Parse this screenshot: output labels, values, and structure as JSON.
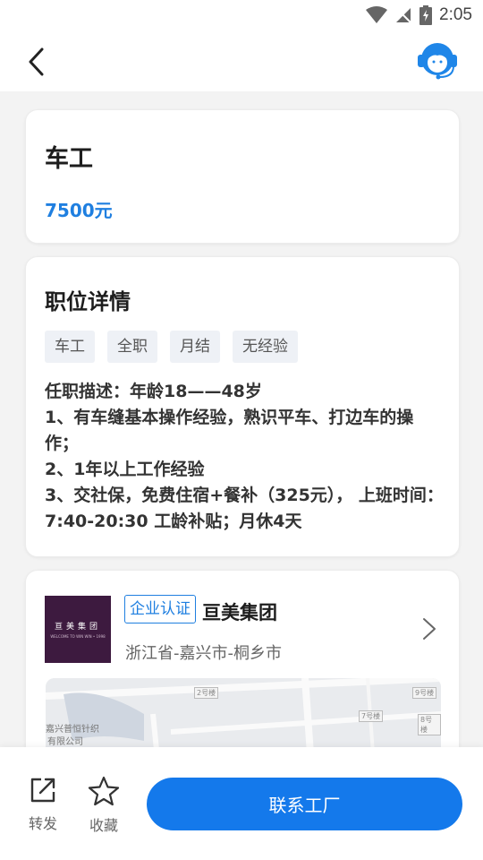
{
  "status_bar": {
    "time": "2:05"
  },
  "job": {
    "title": "车工",
    "salary": "7500元"
  },
  "detail": {
    "heading": "职位详情",
    "tags": [
      "车工",
      "全职",
      "月结",
      "无经验"
    ],
    "description_lines": [
      "任职描述：年龄18——48岁",
      "1、有车缝基本操作经验，熟识平车、打边车的操作；",
      "2、1年以上工作经验",
      "3、交社保，免费住宿+餐补（325元）， 上班时间：7:40-20:30 工龄补贴；月休4天"
    ]
  },
  "company": {
    "logo_text": "亘美集团",
    "logo_subtext": "WELCOME TO WIN WIN • 1998",
    "certification": "企业认证",
    "name": "亘美集团",
    "location": "浙江省-嘉兴市-桐乡市"
  },
  "map": {
    "labels": [
      "2号楼",
      "9号楼",
      "7号楼",
      "8号楼"
    ],
    "texts": [
      "嘉兴普恒针织",
      "有限公司"
    ]
  },
  "bottom_bar": {
    "share_label": "转发",
    "favorite_label": "收藏",
    "contact_label": "联系工厂"
  },
  "colors": {
    "accent": "#1479eb",
    "salary": "#1f7fe0",
    "logo_bg": "#3d1a3f"
  }
}
